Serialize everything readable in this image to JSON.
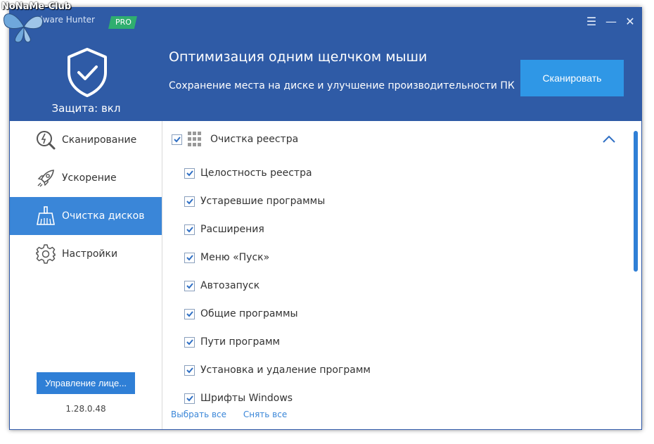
{
  "app": {
    "title": "alware Hunter",
    "badge": "PRO",
    "watermark": "NoNaMe-Club"
  },
  "window_controls": {
    "menu": "☰",
    "minimize": "—",
    "close": "✕"
  },
  "header": {
    "status_label": "Защита: вкл",
    "headline": "Оптимизация одним щелчком мыши",
    "subline": "Сохранение места на диске и улучшение производительности ПК",
    "scan_button": "Сканировать"
  },
  "sidebar": {
    "items": [
      {
        "label": "Сканирование",
        "icon": "scan-icon",
        "active": false
      },
      {
        "label": "Ускорение",
        "icon": "rocket-icon",
        "active": false
      },
      {
        "label": "Очистка дисков",
        "icon": "broom-icon",
        "active": true
      },
      {
        "label": "Настройки",
        "icon": "gear-icon",
        "active": false
      }
    ],
    "license_button": "Управление лице...",
    "version": "1.28.0.48"
  },
  "content": {
    "group": {
      "label": "Очистка реестра",
      "checked": true
    },
    "items": [
      {
        "label": "Целостность реестра",
        "checked": true
      },
      {
        "label": "Устаревшие программы",
        "checked": true
      },
      {
        "label": "Расширения",
        "checked": true
      },
      {
        "label": "Меню «Пуск»",
        "checked": true
      },
      {
        "label": "Автозапуск",
        "checked": true
      },
      {
        "label": "Общие программы",
        "checked": true
      },
      {
        "label": "Пути программ",
        "checked": true
      },
      {
        "label": "Установка и удаление программ",
        "checked": true
      },
      {
        "label": "Шрифты Windows",
        "checked": true
      }
    ],
    "select_all": "Выбрать все",
    "deselect_all": "Снять все"
  },
  "colors": {
    "header_bg": "#2f5ba6",
    "accent": "#3a86d8",
    "scan_button": "#2f97e6",
    "pro_badge": "#2fae6f"
  }
}
